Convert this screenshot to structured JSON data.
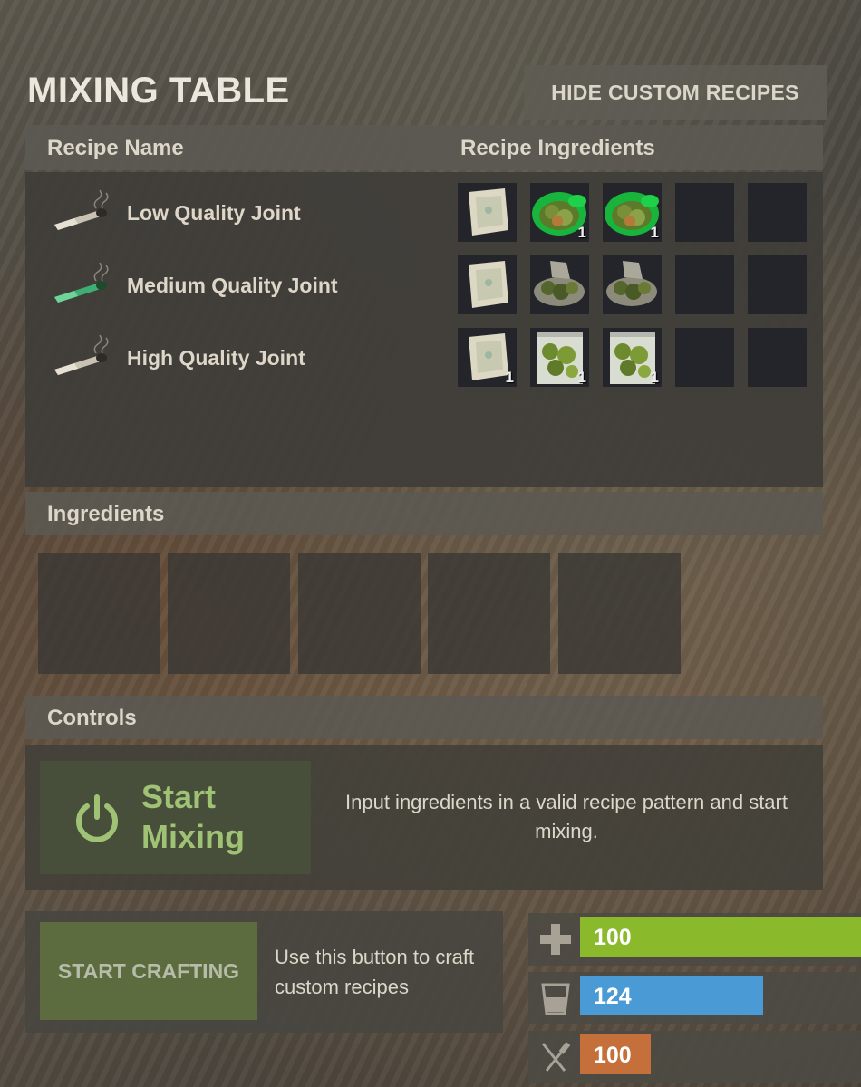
{
  "window": {
    "title": "MIXING TABLE",
    "hide_button": "HIDE CUSTOM RECIPES"
  },
  "recipe_table": {
    "header_name": "Recipe Name",
    "header_ingredients": "Recipe Ingredients",
    "recipes": [
      {
        "name": "Low Quality Joint",
        "icon": "joint-icon",
        "ingredients": [
          {
            "icon": "rolling-paper-icon",
            "quantity": ""
          },
          {
            "icon": "cannabis-jar-icon",
            "quantity": "1"
          },
          {
            "icon": "cannabis-jar-icon",
            "quantity": "1"
          },
          {
            "icon": "empty-slot",
            "quantity": ""
          },
          {
            "icon": "empty-slot",
            "quantity": ""
          }
        ]
      },
      {
        "name": "Medium Quality Joint",
        "icon": "joint-green-icon",
        "ingredients": [
          {
            "icon": "rolling-paper-icon",
            "quantity": ""
          },
          {
            "icon": "cannabis-bag-open-icon",
            "quantity": ""
          },
          {
            "icon": "cannabis-bag-open-icon",
            "quantity": ""
          },
          {
            "icon": "empty-slot",
            "quantity": ""
          },
          {
            "icon": "empty-slot",
            "quantity": ""
          }
        ]
      },
      {
        "name": "High Quality Joint",
        "icon": "joint-icon",
        "ingredients": [
          {
            "icon": "rolling-paper-icon",
            "quantity": "1"
          },
          {
            "icon": "cannabis-bag-sealed-icon",
            "quantity": "1"
          },
          {
            "icon": "cannabis-bag-sealed-icon",
            "quantity": "1"
          },
          {
            "icon": "empty-slot",
            "quantity": ""
          },
          {
            "icon": "empty-slot",
            "quantity": ""
          }
        ]
      }
    ]
  },
  "ingredients_section": {
    "header": "Ingredients",
    "slot_count": 5
  },
  "controls": {
    "header": "Controls",
    "start_mixing_line1": "Start",
    "start_mixing_line2": "Mixing",
    "description": "Input ingredients in a valid recipe pattern and start mixing."
  },
  "crafting": {
    "button": "START CRAFTING",
    "description": "Use this button to craft custom recipes"
  },
  "stats": {
    "health": {
      "icon": "health-cross-icon",
      "value": "100",
      "color": "#8ab92c",
      "fill": 1.0
    },
    "water": {
      "icon": "water-cup-icon",
      "value": "124",
      "color": "#4a9ad6",
      "fill": 0.65
    },
    "food": {
      "icon": "fork-knife-icon",
      "value": "100",
      "color": "#c5703a",
      "fill": 0.25
    }
  },
  "colors": {
    "accent_green": "#9fc274",
    "slot_bg": "#23252a",
    "craft_button": "#5c6c3f"
  }
}
